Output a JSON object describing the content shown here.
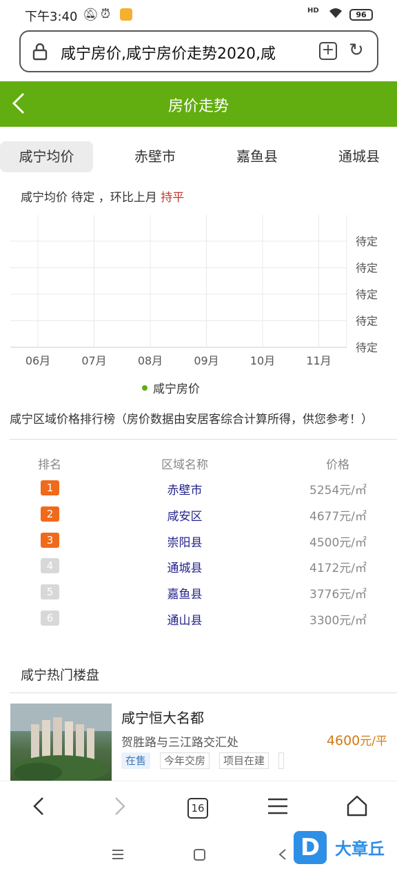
{
  "status_bar": {
    "time": "下午3:40",
    "signal": "HD",
    "battery": "96"
  },
  "address_bar": {
    "url_text": "咸宁房价,咸宁房价走势2020,咸"
  },
  "header": {
    "title": "房价走势"
  },
  "tabs": [
    {
      "label": "咸宁均价",
      "active": true
    },
    {
      "label": "赤壁市",
      "active": false
    },
    {
      "label": "嘉鱼县",
      "active": false
    },
    {
      "label": "通城县",
      "active": false
    }
  ],
  "summary": {
    "prefix": "咸宁均价 待定 ，环比上月 ",
    "trend": "持平"
  },
  "chart_data": {
    "type": "line",
    "x": [
      "06月",
      "07月",
      "08月",
      "09月",
      "10月",
      "11月"
    ],
    "y_tick_labels": [
      "待定",
      "待定",
      "待定",
      "待定",
      "待定"
    ],
    "series": [
      {
        "name": "咸宁房价",
        "values": [],
        "color": "#62ad10"
      }
    ],
    "grid": true,
    "legend": "bottom-center"
  },
  "ranking": {
    "title": "咸宁区域价格排行榜（房价数据由安居客综合计算所得，供您参考！）",
    "headers": {
      "rank": "排名",
      "area": "区域名称",
      "price": "价格"
    },
    "rows": [
      {
        "rank": "1",
        "area": "赤壁市",
        "price": "5254元/㎡",
        "badge_color": "#f06a1b"
      },
      {
        "rank": "2",
        "area": "咸安区",
        "price": "4677元/㎡",
        "badge_color": "#f06a1b"
      },
      {
        "rank": "3",
        "area": "崇阳县",
        "price": "4500元/㎡",
        "badge_color": "#f06a1b"
      },
      {
        "rank": "4",
        "area": "通城县",
        "price": "4172元/㎡",
        "badge_color": "#d8d8d8"
      },
      {
        "rank": "5",
        "area": "嘉鱼县",
        "price": "3776元/㎡",
        "badge_color": "#d8d8d8"
      },
      {
        "rank": "6",
        "area": "通山县",
        "price": "3300元/㎡",
        "badge_color": "#d8d8d8"
      }
    ]
  },
  "hot": {
    "title": "咸宁热门楼盘",
    "listing": {
      "name": "咸宁恒大名都",
      "address": "贺胜路与三江路交汇处",
      "price": "4600",
      "price_unit": "元/平",
      "tags": [
        "在售",
        "今年交房",
        "项目在建"
      ]
    }
  },
  "toolbar": {
    "tab_count": "16"
  },
  "watermark": {
    "logo_letter": "D",
    "text": "大章丘"
  }
}
